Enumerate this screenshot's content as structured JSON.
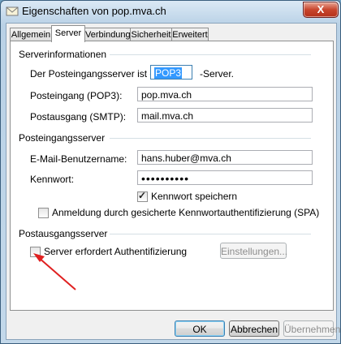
{
  "window": {
    "title": "Eigenschaften von pop.mva.ch",
    "close_label": "X"
  },
  "tabs": [
    "Allgemein",
    "Server",
    "Verbindung",
    "Sicherheit",
    "Erweitert"
  ],
  "active_tab": "Server",
  "server_info": {
    "group_label": "Serverinformationen",
    "incoming_type_label": "Der Posteingangsserver ist ein",
    "incoming_type_value": "POP3",
    "incoming_type_suffix": "-Server.",
    "incoming_label": "Posteingang (POP3):",
    "incoming_value": "pop.mva.ch",
    "outgoing_label": "Postausgang (SMTP):",
    "outgoing_value": "mail.mva.ch"
  },
  "incoming_server": {
    "group_label": "Posteingangsserver",
    "username_label": "E-Mail-Benutzername:",
    "username_value": "hans.huber@mva.ch",
    "password_label": "Kennwort:",
    "password_value": "••••••••••",
    "save_password_label": "Kennwort speichern",
    "save_password_checked": true,
    "spa_label": "Anmeldung durch gesicherte Kennwortauthentifizierung (SPA)",
    "spa_checked": false
  },
  "outgoing_server": {
    "group_label": "Postausgangsserver",
    "auth_label": "Server erfordert Authentifizierung",
    "auth_checked": false,
    "settings_button": "Einstellungen..."
  },
  "footer": {
    "ok": "OK",
    "cancel": "Abbrechen",
    "apply": "Übernehmen"
  },
  "colors": {
    "annotation_arrow": "#e02020",
    "selection": "#3399ff"
  }
}
